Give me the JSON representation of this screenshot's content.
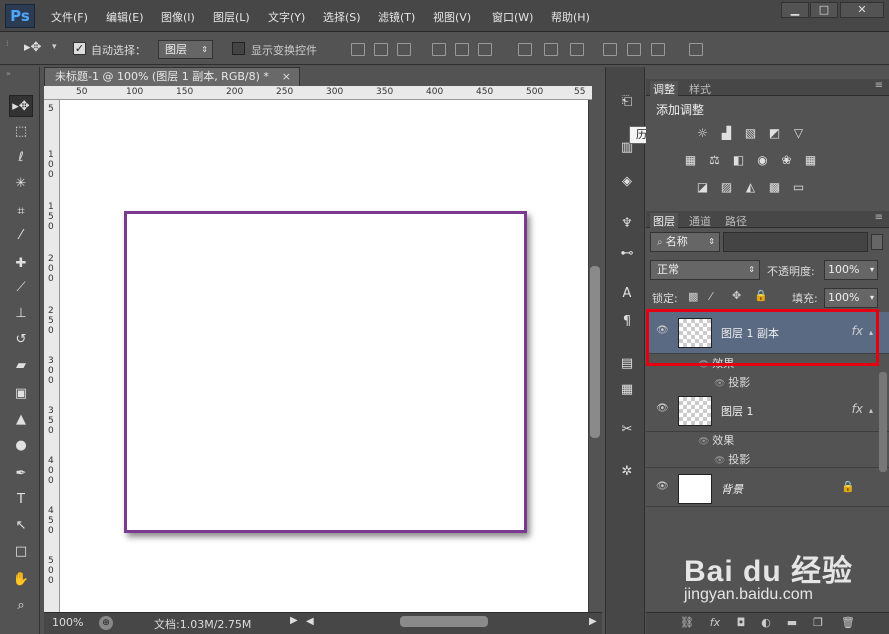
{
  "app": {
    "logo": "Ps"
  },
  "menu": [
    "文件(F)",
    "编辑(E)",
    "图像(I)",
    "图层(L)",
    "文字(Y)",
    "选择(S)",
    "滤镜(T)",
    "视图(V)",
    "窗口(W)",
    "帮助(H)"
  ],
  "window_controls": {
    "minimize": "▁",
    "maximize": "□",
    "close": "✕"
  },
  "options": {
    "auto_select_label": "自动选择：",
    "auto_select_checked": true,
    "auto_select_value": "图层",
    "show_transform_label": "显示变换控件",
    "show_transform_checked": false
  },
  "document": {
    "tab_title": "未标题-1 @ 100% (图层 1 副本, RGB/8) *",
    "tab_close": "×",
    "zoom": "100%",
    "doc_info": "文档:1.03M/2.75M"
  },
  "ruler": {
    "h": [
      "50",
      "100",
      "150",
      "200",
      "250",
      "300",
      "350",
      "400",
      "450",
      "500",
      "55"
    ],
    "v": [
      "5",
      "100",
      "150",
      "200",
      "250",
      "300",
      "350",
      "400",
      "450",
      "500"
    ]
  },
  "tooltip": "历史记录",
  "adjust_panel": {
    "tabs": [
      "调整",
      "样式"
    ],
    "title": "添加调整"
  },
  "layers_panel": {
    "tabs": [
      "图层",
      "通道",
      "路径"
    ],
    "filter_kind": "名称",
    "blend_mode": "正常",
    "opacity_label": "不透明度:",
    "opacity": "100%",
    "lock_label": "锁定:",
    "fill_label": "填充:",
    "fill": "100%",
    "layers": [
      {
        "name": "图层 1 副本",
        "fx": "fx",
        "effects_label": "效果",
        "effect": "投影",
        "selected": true
      },
      {
        "name": "图层 1",
        "fx": "fx",
        "effects_label": "效果",
        "effect": "投影",
        "selected": false
      },
      {
        "name": "背景",
        "locked": true,
        "selected": false
      }
    ]
  },
  "watermark": {
    "brand": "Bai du 经验",
    "url": "jingyan.baidu.com"
  },
  "colors": {
    "selected_layer": "#5a6a82",
    "highlight": "#e50011",
    "shape_stroke": "#7a3a8f"
  }
}
